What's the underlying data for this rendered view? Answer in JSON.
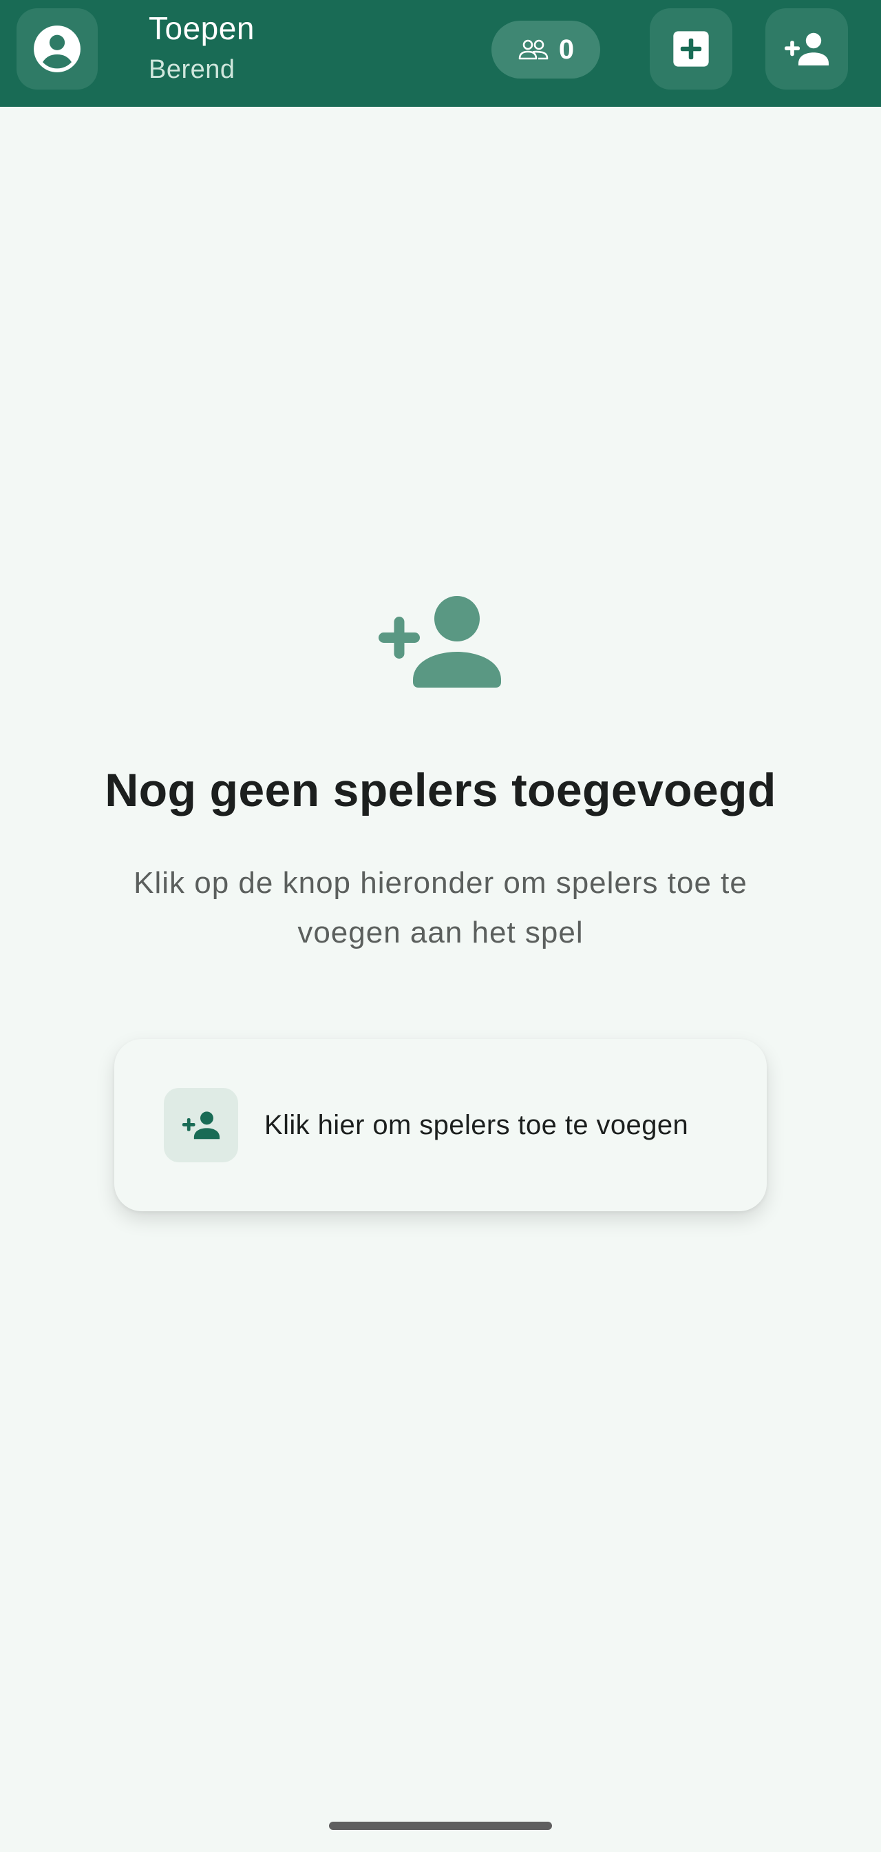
{
  "header": {
    "title": "Toepen",
    "subtitle": "Berend",
    "player_count": "0",
    "icons": {
      "profile": "account-circle-icon",
      "players": "group-icon",
      "new_game": "add-box-icon",
      "add_player": "person-add-icon"
    }
  },
  "empty_state": {
    "icon": "person-add-icon",
    "title": "Nog geen spelers toegevoegd",
    "description": "Klik op de knop hieronder om spelers toe te voegen aan het spel"
  },
  "add_card": {
    "icon": "person-add-icon",
    "label": "Klik hier om spelers toe te voegen"
  },
  "colors": {
    "primary": "#196b55",
    "background": "#f3f8f5",
    "icon_muted": "#5a9883",
    "text_dark": "#1c1f1e",
    "text_muted": "#5b5f5d"
  }
}
